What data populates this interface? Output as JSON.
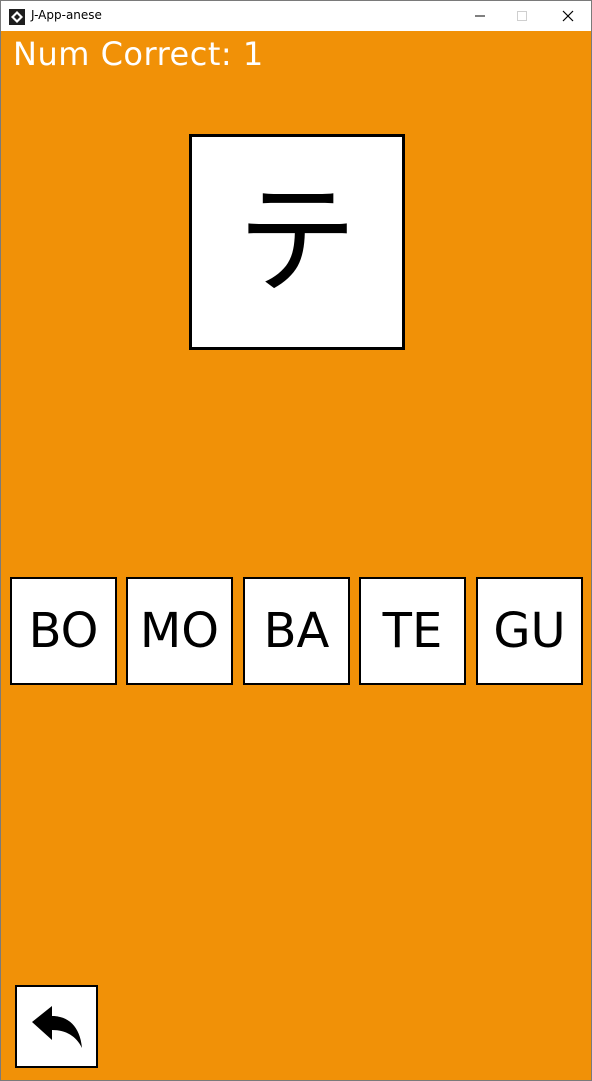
{
  "window": {
    "title": "J-App-anese"
  },
  "score": {
    "text": "Num Correct: 1"
  },
  "prompt": {
    "character": "テ"
  },
  "choices": [
    "BO",
    "MO",
    "BA",
    "TE",
    "GU"
  ],
  "colors": {
    "background": "#f19107",
    "card": "#ffffff",
    "border": "#000000",
    "score_text": "#ffffff"
  },
  "icons": {
    "back": "back-arrow-icon"
  }
}
